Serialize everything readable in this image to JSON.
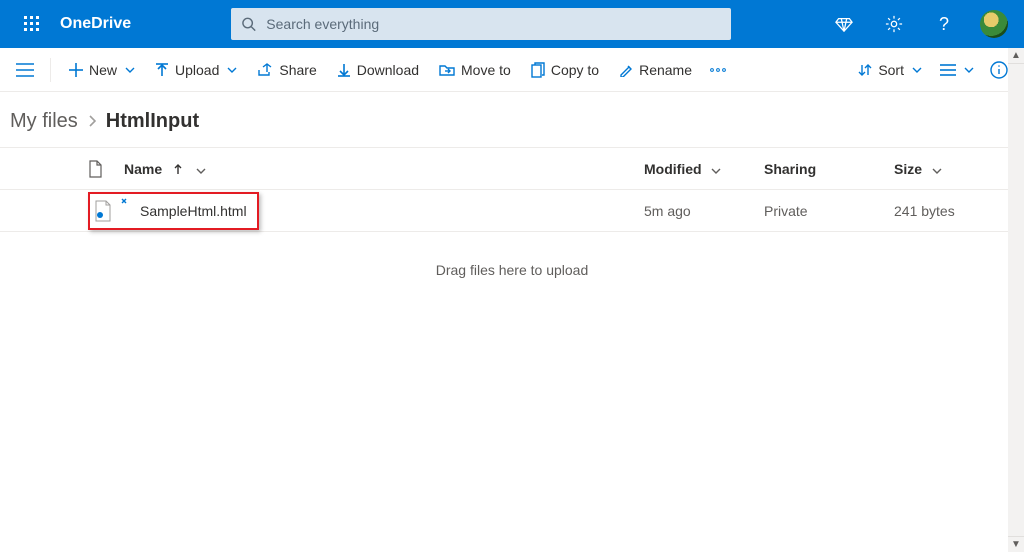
{
  "header": {
    "brand": "OneDrive",
    "search_placeholder": "Search everything"
  },
  "commands": {
    "new": "New",
    "upload": "Upload",
    "share": "Share",
    "download": "Download",
    "moveto": "Move to",
    "copyto": "Copy to",
    "rename": "Rename",
    "sort": "Sort"
  },
  "breadcrumb": {
    "root": "My files",
    "leaf": "HtmlInput"
  },
  "columns": {
    "name": "Name",
    "modified": "Modified",
    "sharing": "Sharing",
    "size": "Size"
  },
  "rows": [
    {
      "name": "SampleHtml.html",
      "modified": "5m ago",
      "sharing": "Private",
      "size": "241 bytes"
    }
  ],
  "drag_hint": "Drag files here to upload"
}
